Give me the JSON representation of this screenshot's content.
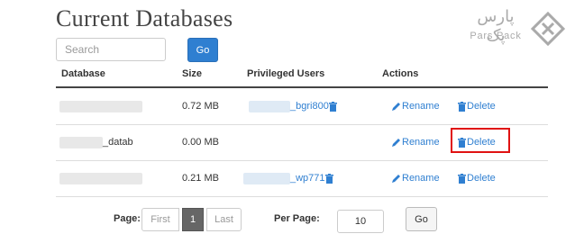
{
  "page": {
    "title": "Current Databases"
  },
  "search": {
    "placeholder": "Search",
    "go_label": "Go"
  },
  "table": {
    "headers": [
      "Database",
      "Size",
      "Privileged Users",
      "Actions"
    ],
    "rows": [
      {
        "name": "",
        "size": "0.72 MB",
        "user": "_bgri800",
        "rename": "Rename",
        "delete": "Delete"
      },
      {
        "name": "_datab",
        "size": "0.00 MB",
        "user": "",
        "rename": "Rename",
        "delete": "Delete"
      },
      {
        "name": "",
        "size": "0.21 MB",
        "user": "_wp771",
        "rename": "Rename",
        "delete": "Delete"
      }
    ]
  },
  "pagination": {
    "page_label": "Page:",
    "first": "First",
    "current": "1",
    "last": "Last",
    "per_page_label": "Per Page:",
    "per_page_value": "10",
    "go_label": "Go"
  },
  "brand": {
    "name_fa": "پارس پک",
    "name_en": "Pars Pack"
  },
  "colors": {
    "link": "#2f7fd1",
    "highlight": "#e01212",
    "header_rule": "#444444"
  }
}
